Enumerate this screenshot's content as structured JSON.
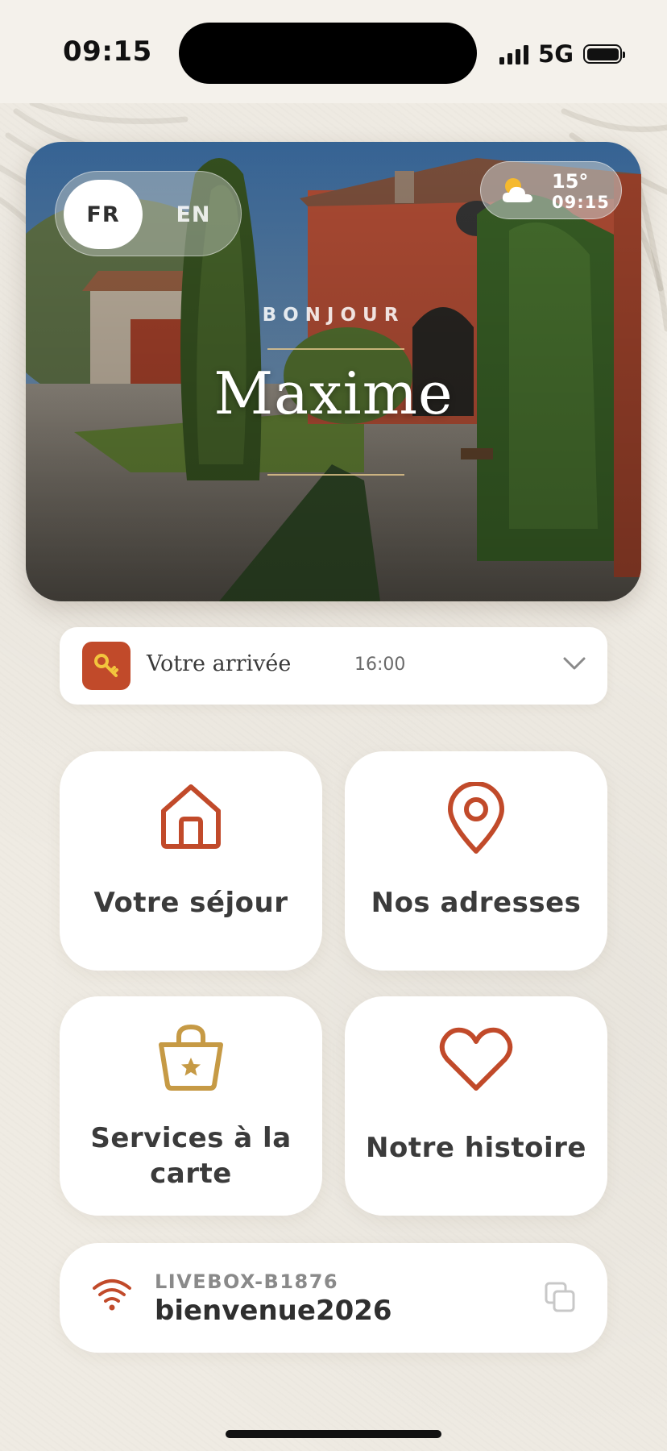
{
  "status_bar": {
    "time": "09:15",
    "network": "5G",
    "battery_level": 1.0
  },
  "hero": {
    "languages": [
      {
        "code": "FR",
        "selected": true
      },
      {
        "code": "EN",
        "selected": false
      }
    ],
    "weather": {
      "icon": "partly-cloudy-icon",
      "temperature": "15°",
      "time": "09:15"
    },
    "greeting": "BONJOUR",
    "guest_name": "Maxime"
  },
  "arrival": {
    "icon": "key-icon",
    "label": "Votre arrivée",
    "time": "16:00",
    "toggle_icon": "chevron-down-icon"
  },
  "tiles": [
    {
      "icon": "home-icon",
      "label": "Votre séjour",
      "color": "#c14a2a"
    },
    {
      "icon": "map-pin-icon",
      "label": "Nos adresses",
      "color": "#c14a2a"
    },
    {
      "icon": "shopping-basket-star-icon",
      "label": "Services à la carte",
      "color": "#c69a45"
    },
    {
      "icon": "heart-icon",
      "label": "Notre histoire",
      "color": "#c14a2a"
    }
  ],
  "wifi": {
    "icon": "wifi-icon",
    "network_name": "LIVEBOX-B1876",
    "password": "bienvenue2026",
    "copy_icon": "copy-icon"
  },
  "colors": {
    "accent": "#c14a2a",
    "gold": "#c69a45",
    "background": "#efebe3"
  }
}
